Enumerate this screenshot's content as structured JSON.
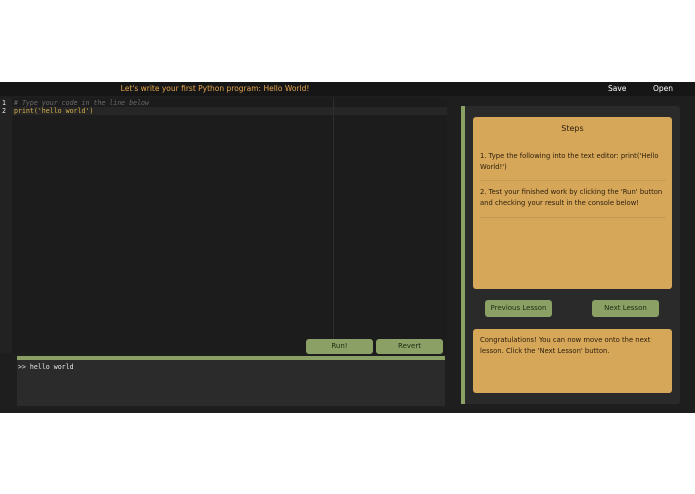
{
  "header": {
    "title": "Let's write your first Python program: Hello World!",
    "save_label": "Save",
    "open_label": "Open"
  },
  "editor": {
    "line_numbers": [
      "1",
      "2"
    ],
    "lines": [
      "# Type your code in the line below",
      "print('hello world')"
    ]
  },
  "buttons": {
    "run_label": "Run!",
    "revert_label": "Revert"
  },
  "console": {
    "output": ">> hello world"
  },
  "steps": {
    "title": "Steps",
    "items": [
      "1. Type the following into the text editor: print('Hello World!')",
      "2. Test your finished work by clicking the 'Run' button and checking your result in the console below!"
    ]
  },
  "lesson_nav": {
    "previous_label": "Previous Lesson",
    "next_label": "Next Lesson"
  },
  "message": {
    "text": "Congratulations! You can now move onto the next lesson. Click the 'Next Lesson' button."
  },
  "colors": {
    "accent_green": "#8aa065",
    "card_tan": "#d6a659",
    "title_orange": "#e8a64f",
    "editor_bg": "#1c1c1c"
  }
}
